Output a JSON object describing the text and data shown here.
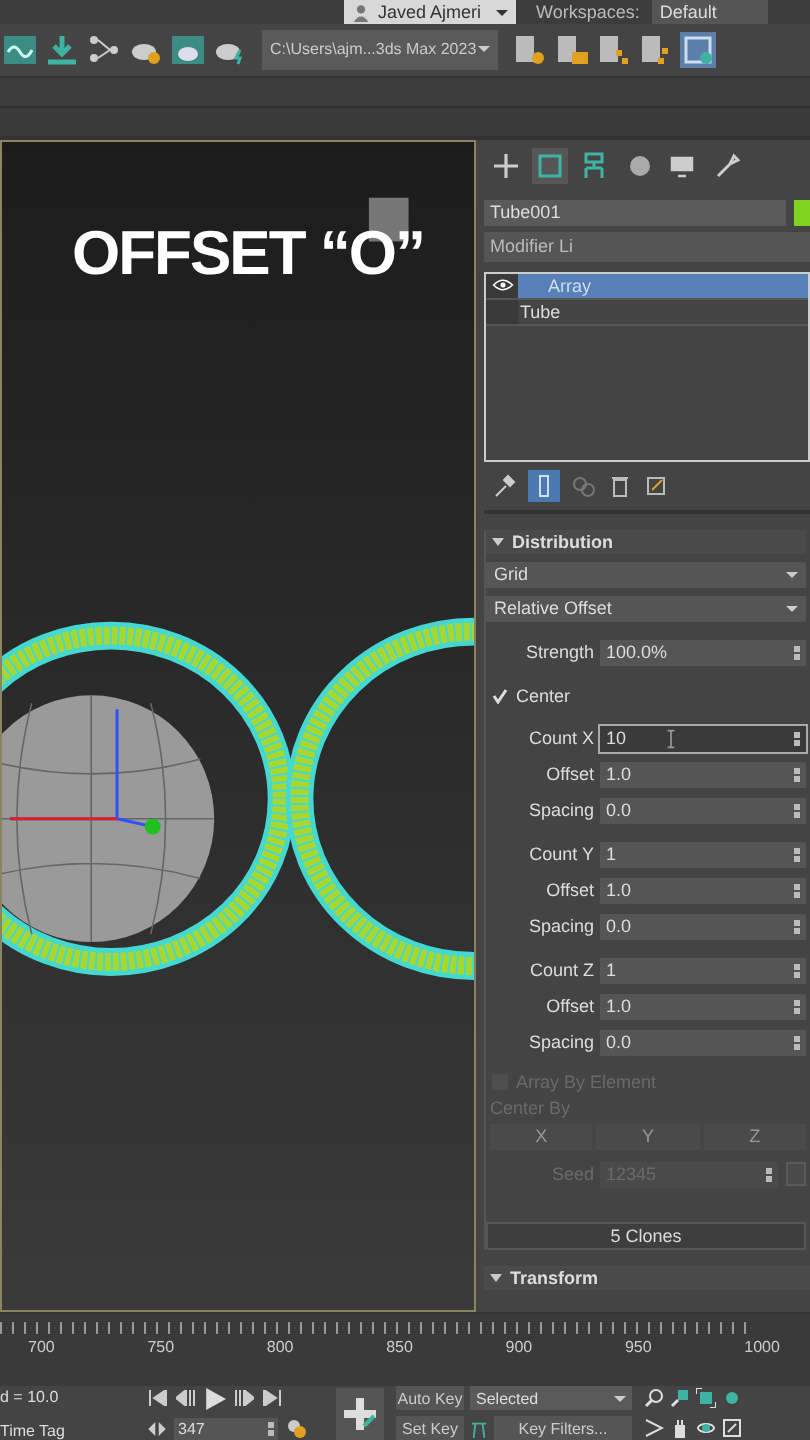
{
  "top_bar": {
    "user": "Javed Ajmeri",
    "workspaces_label": "Workspaces:",
    "workspace": "Default"
  },
  "toolbar": {
    "project_path": "C:\\Users\\ajm...3ds Max 2023"
  },
  "viewport": {
    "caption": "OFFSET “O”"
  },
  "command_panel": {
    "tabs": [
      {
        "kind": "create",
        "selected": false
      },
      {
        "kind": "modify",
        "selected": true
      },
      {
        "kind": "hierarchy",
        "selected": false
      },
      {
        "kind": "motion",
        "selected": false
      },
      {
        "kind": "display",
        "selected": false
      },
      {
        "kind": "utilities",
        "selected": false
      }
    ],
    "object_name": "Tube001",
    "modifier_list": "Modifier Li",
    "stack": [
      {
        "label": "Array",
        "selected": true,
        "visible": true
      },
      {
        "label": "Tube",
        "selected": false,
        "visible": false
      }
    ],
    "rollout": {
      "title": "Distribution",
      "type": "Grid",
      "mode": "Relative Offset",
      "groups": [
        {
          "rows": [
            {
              "kind": "spinner",
              "label": "Strength",
              "value": "100.0%",
              "focused": false
            }
          ]
        },
        {
          "rows": [
            {
              "kind": "checkbox",
              "label": "Center",
              "checked": true
            }
          ]
        },
        {
          "rows": [
            {
              "kind": "spinner",
              "label": "Count X",
              "value": "10",
              "focused": true
            },
            {
              "kind": "spinner",
              "label": "Offset",
              "value": "1.0",
              "focused": false
            },
            {
              "kind": "spinner",
              "label": "Spacing",
              "value": "0.0",
              "focused": false
            }
          ]
        },
        {
          "rows": [
            {
              "kind": "spinner",
              "label": "Count Y",
              "value": "1",
              "focused": false
            },
            {
              "kind": "spinner",
              "label": "Offset",
              "value": "1.0",
              "focused": false
            },
            {
              "kind": "spinner",
              "label": "Spacing",
              "value": "0.0",
              "focused": false
            }
          ]
        },
        {
          "rows": [
            {
              "kind": "spinner",
              "label": "Count Z",
              "value": "1",
              "focused": false
            },
            {
              "kind": "spinner",
              "label": "Offset",
              "value": "1.0",
              "focused": false
            },
            {
              "kind": "spinner",
              "label": "Spacing",
              "value": "0.0",
              "focused": false
            }
          ]
        }
      ],
      "array_by_element": {
        "label": "Array By Element",
        "checked": false,
        "disabled": true
      },
      "center_by": {
        "label": "Center By",
        "axes": [
          "X",
          "Y",
          "Z"
        ],
        "disabled": true
      },
      "seed": {
        "label": "Seed",
        "value": "12345",
        "disabled": true
      },
      "clones_button": "5 Clones"
    },
    "next_rollout": "Transform"
  },
  "timeline": {
    "ticks": [
      "700",
      "750",
      "800",
      "850",
      "900",
      "950",
      "1000"
    ]
  },
  "bottom_bar": {
    "status": "d = 10.0",
    "time_tag": "Time Tag",
    "frame": "347",
    "auto_key": "Auto Key",
    "set_key": "Set Key",
    "key_mode": "Selected",
    "key_filters": "Key Filters..."
  }
}
